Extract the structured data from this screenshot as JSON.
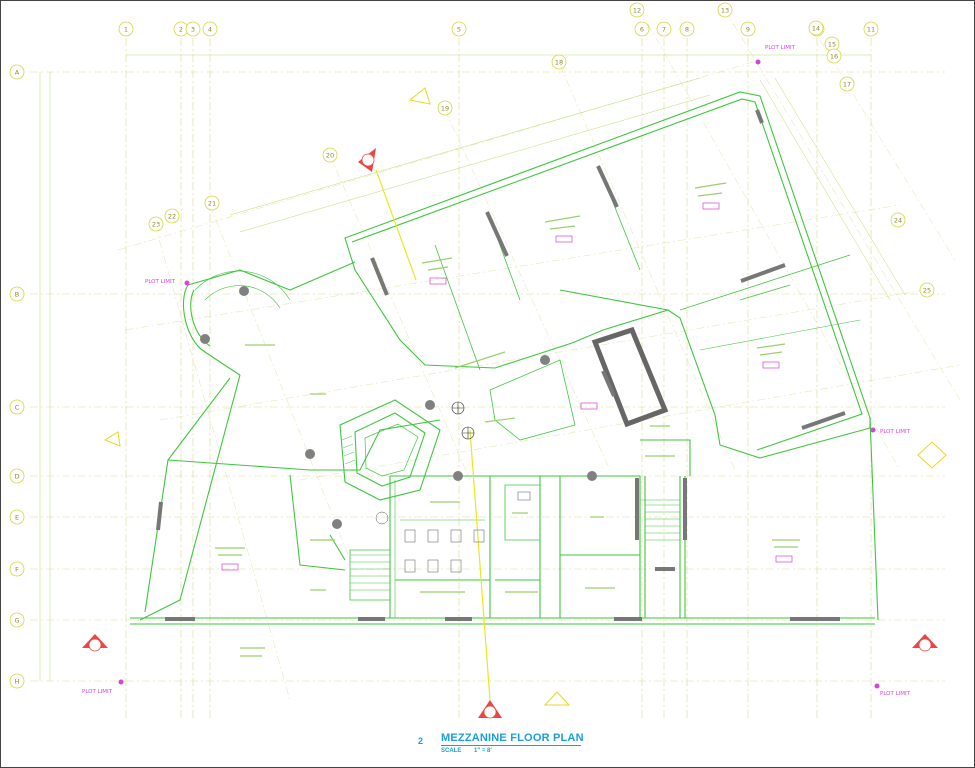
{
  "drawing": {
    "number": "2",
    "title": "MEZZANINE FLOOR PLAN",
    "scale_label": "SCALE",
    "scale_value": "1\" = 8'"
  },
  "grid_top": [
    "1",
    "2",
    "3",
    "4",
    "5",
    "6",
    "7",
    "8",
    "9",
    "10",
    "11"
  ],
  "grid_left": [
    "A",
    "B",
    "C",
    "D",
    "E",
    "F",
    "G",
    "H"
  ],
  "rotated_grid": [
    "12",
    "13",
    "14",
    "15",
    "16",
    "17",
    "18",
    "19",
    "20",
    "21",
    "22",
    "23",
    "24",
    "25"
  ],
  "plot_limit_label": "PLOT LIMIT",
  "section_markers": [
    "A",
    "B"
  ],
  "colors": {
    "walls": "#33cc33",
    "grid": "#dddd55",
    "column": "#7f7f7f",
    "section": "#ee4444",
    "title": "#1a9fd8",
    "magenta": "#cc33cc"
  }
}
